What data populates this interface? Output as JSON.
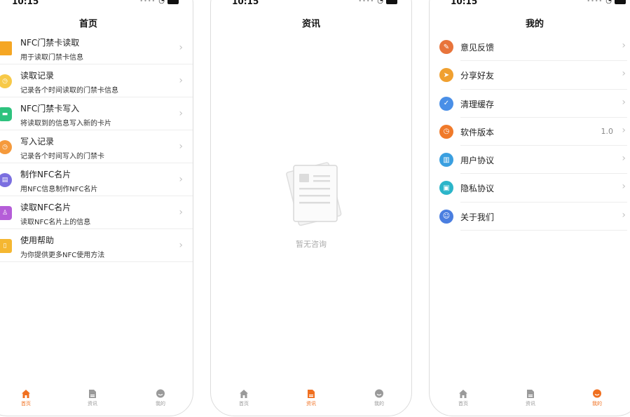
{
  "status": {
    "time": "10:15"
  },
  "colors": {
    "accent": "#f07020",
    "tab_inactive": "#9a9a9a"
  },
  "home": {
    "title": "首页",
    "items": [
      {
        "title": "NFC门禁卡读取",
        "desc": "用于读取门禁卡信息",
        "icon": "card-reader-icon",
        "color": "#f5a623"
      },
      {
        "title": "读取记录",
        "desc": "记录各个时间读取的门禁卡信息",
        "icon": "clock-icon",
        "color": "#f7c948"
      },
      {
        "title": "NFC门禁卡写入",
        "desc": "将读取到的信息写入新的卡片",
        "icon": "card-write-icon",
        "color": "#2ec27e"
      },
      {
        "title": "写入记录",
        "desc": "记录各个时间写入的门禁卡",
        "icon": "write-clock-icon",
        "color": "#f59a3c"
      },
      {
        "title": "制作NFC名片",
        "desc": "用NFC信息制作NFC名片",
        "icon": "make-card-icon",
        "color": "#7b6fe0"
      },
      {
        "title": "读取NFC名片",
        "desc": "读取NFC名片上的信息",
        "icon": "contact-card-icon",
        "color": "#b55dd8"
      },
      {
        "title": "使用帮助",
        "desc": "为你提供更多NFC使用方法",
        "icon": "help-book-icon",
        "color": "#f5b731"
      }
    ]
  },
  "news": {
    "title": "资讯",
    "empty_text": "暂无咨询"
  },
  "me": {
    "title": "我的",
    "items": [
      {
        "label": "意见反馈",
        "value": "",
        "icon": "feedback-icon",
        "color": "#e8743b"
      },
      {
        "label": "分享好友",
        "value": "",
        "icon": "share-icon",
        "color": "#f0a030"
      },
      {
        "label": "清理缓存",
        "value": "",
        "icon": "clean-icon",
        "color": "#4a8fe7"
      },
      {
        "label": "软件版本",
        "value": "1.0",
        "icon": "version-clock-icon",
        "color": "#f07a2a"
      },
      {
        "label": "用户协议",
        "value": "",
        "icon": "book-icon",
        "color": "#3a9fe0"
      },
      {
        "label": "隐私协议",
        "value": "",
        "icon": "lock-icon",
        "color": "#2bb5c9"
      },
      {
        "label": "关于我们",
        "value": "",
        "icon": "about-icon",
        "color": "#4a7ee0"
      }
    ]
  },
  "tabs": [
    {
      "label": "首页",
      "icon": "home-icon"
    },
    {
      "label": "资讯",
      "icon": "document-icon"
    },
    {
      "label": "我的",
      "icon": "chat-icon"
    }
  ],
  "active_tabs": {
    "home": 0,
    "news": 1,
    "me": 2
  }
}
